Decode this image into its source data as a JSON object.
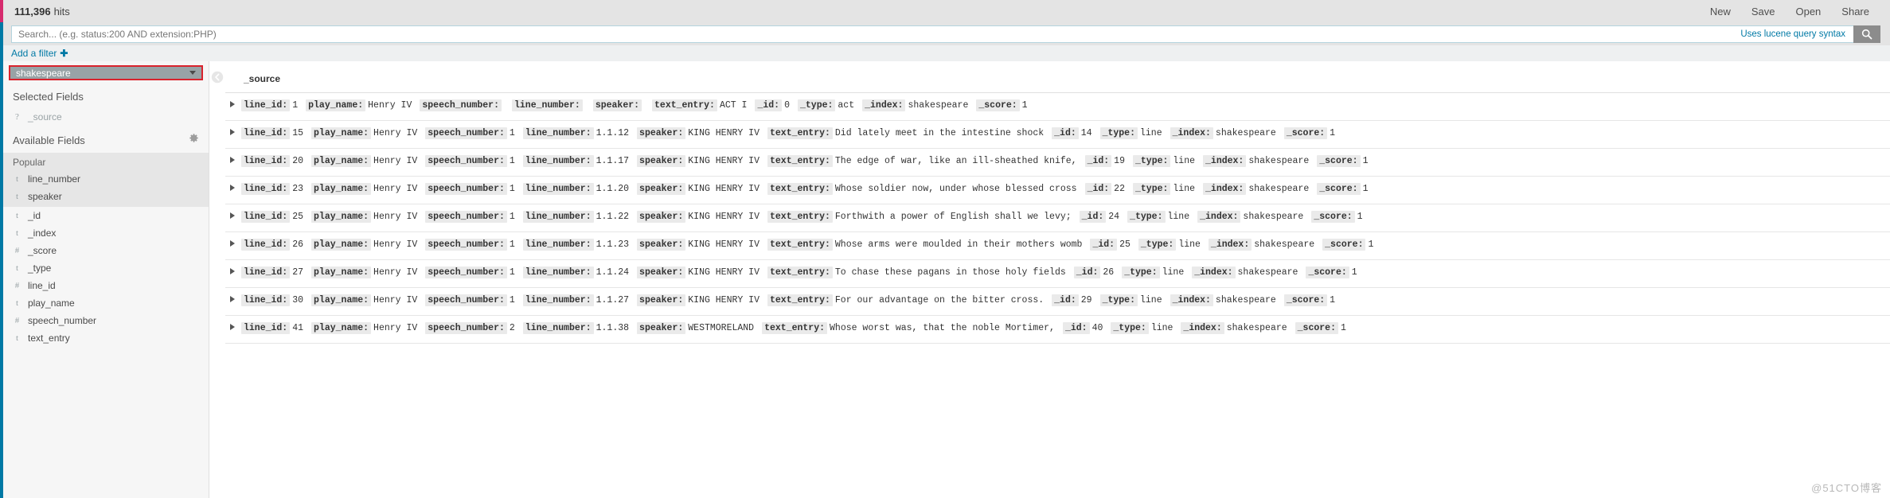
{
  "topbar": {
    "hits_count": "111,396",
    "hits_label": "hits",
    "nav": [
      {
        "label": "New",
        "name": "new"
      },
      {
        "label": "Save",
        "name": "save"
      },
      {
        "label": "Open",
        "name": "open"
      },
      {
        "label": "Share",
        "name": "share"
      }
    ]
  },
  "search": {
    "value": "",
    "placeholder": "Search... (e.g. status:200 AND extension:PHP)",
    "lucene_hint": "Uses lucene query syntax",
    "search_icon": "search-icon"
  },
  "filters": {
    "add_filter_label": "Add a filter",
    "plus": "✚"
  },
  "sidebar": {
    "index_pattern": "shakespeare",
    "selected_fields_title": "Selected Fields",
    "selected_fields": [
      {
        "type": "?",
        "name": "_source",
        "muted": true
      }
    ],
    "available_fields_title": "Available Fields",
    "gear_icon": "gear-icon",
    "popular_label": "Popular",
    "popular_fields": [
      {
        "type": "t",
        "name": "line_number"
      },
      {
        "type": "t",
        "name": "speaker"
      }
    ],
    "available_fields": [
      {
        "type": "t",
        "name": "_id"
      },
      {
        "type": "t",
        "name": "_index"
      },
      {
        "type": "#",
        "name": "_score"
      },
      {
        "type": "t",
        "name": "_type"
      },
      {
        "type": "#",
        "name": "line_id"
      },
      {
        "type": "t",
        "name": "play_name"
      },
      {
        "type": "#",
        "name": "speech_number"
      },
      {
        "type": "t",
        "name": "text_entry"
      }
    ]
  },
  "table": {
    "collapse_icon": "chevron-left-icon",
    "column_header": "_source",
    "rows": [
      {
        "fields": [
          {
            "key": "line_id:",
            "value": "1"
          },
          {
            "key": "play_name:",
            "value": "Henry IV"
          },
          {
            "key": "speech_number:",
            "value": ""
          },
          {
            "key": "line_number:",
            "value": ""
          },
          {
            "key": "speaker:",
            "value": ""
          },
          {
            "key": "text_entry:",
            "value": "ACT I"
          },
          {
            "key": "_id:",
            "value": "0"
          },
          {
            "key": "_type:",
            "value": "act"
          },
          {
            "key": "_index:",
            "value": "shakespeare"
          },
          {
            "key": "_score:",
            "value": "1"
          }
        ]
      },
      {
        "fields": [
          {
            "key": "line_id:",
            "value": "15"
          },
          {
            "key": "play_name:",
            "value": "Henry IV"
          },
          {
            "key": "speech_number:",
            "value": "1"
          },
          {
            "key": "line_number:",
            "value": "1.1.12"
          },
          {
            "key": "speaker:",
            "value": "KING HENRY IV"
          },
          {
            "key": "text_entry:",
            "value": "Did lately meet in the intestine shock"
          },
          {
            "key": "_id:",
            "value": "14"
          },
          {
            "key": "_type:",
            "value": "line"
          },
          {
            "key": "_index:",
            "value": "shakespeare"
          },
          {
            "key": "_score:",
            "value": "1"
          }
        ]
      },
      {
        "fields": [
          {
            "key": "line_id:",
            "value": "20"
          },
          {
            "key": "play_name:",
            "value": "Henry IV"
          },
          {
            "key": "speech_number:",
            "value": "1"
          },
          {
            "key": "line_number:",
            "value": "1.1.17"
          },
          {
            "key": "speaker:",
            "value": "KING HENRY IV"
          },
          {
            "key": "text_entry:",
            "value": "The edge of war, like an ill-sheathed knife,"
          },
          {
            "key": "_id:",
            "value": "19"
          },
          {
            "key": "_type:",
            "value": "line"
          },
          {
            "key": "_index:",
            "value": "shakespeare"
          },
          {
            "key": "_score:",
            "value": "1"
          }
        ]
      },
      {
        "fields": [
          {
            "key": "line_id:",
            "value": "23"
          },
          {
            "key": "play_name:",
            "value": "Henry IV"
          },
          {
            "key": "speech_number:",
            "value": "1"
          },
          {
            "key": "line_number:",
            "value": "1.1.20"
          },
          {
            "key": "speaker:",
            "value": "KING HENRY IV"
          },
          {
            "key": "text_entry:",
            "value": "Whose soldier now, under whose blessed cross"
          },
          {
            "key": "_id:",
            "value": "22"
          },
          {
            "key": "_type:",
            "value": "line"
          },
          {
            "key": "_index:",
            "value": "shakespeare"
          },
          {
            "key": "_score:",
            "value": "1"
          }
        ]
      },
      {
        "fields": [
          {
            "key": "line_id:",
            "value": "25"
          },
          {
            "key": "play_name:",
            "value": "Henry IV"
          },
          {
            "key": "speech_number:",
            "value": "1"
          },
          {
            "key": "line_number:",
            "value": "1.1.22"
          },
          {
            "key": "speaker:",
            "value": "KING HENRY IV"
          },
          {
            "key": "text_entry:",
            "value": "Forthwith a power of English shall we levy;"
          },
          {
            "key": "_id:",
            "value": "24"
          },
          {
            "key": "_type:",
            "value": "line"
          },
          {
            "key": "_index:",
            "value": "shakespeare"
          },
          {
            "key": "_score:",
            "value": "1"
          }
        ]
      },
      {
        "fields": [
          {
            "key": "line_id:",
            "value": "26"
          },
          {
            "key": "play_name:",
            "value": "Henry IV"
          },
          {
            "key": "speech_number:",
            "value": "1"
          },
          {
            "key": "line_number:",
            "value": "1.1.23"
          },
          {
            "key": "speaker:",
            "value": "KING HENRY IV"
          },
          {
            "key": "text_entry:",
            "value": "Whose arms were moulded in their mothers womb"
          },
          {
            "key": "_id:",
            "value": "25"
          },
          {
            "key": "_type:",
            "value": "line"
          },
          {
            "key": "_index:",
            "value": "shakespeare"
          },
          {
            "key": "_score:",
            "value": "1"
          }
        ]
      },
      {
        "fields": [
          {
            "key": "line_id:",
            "value": "27"
          },
          {
            "key": "play_name:",
            "value": "Henry IV"
          },
          {
            "key": "speech_number:",
            "value": "1"
          },
          {
            "key": "line_number:",
            "value": "1.1.24"
          },
          {
            "key": "speaker:",
            "value": "KING HENRY IV"
          },
          {
            "key": "text_entry:",
            "value": "To chase these pagans in those holy fields"
          },
          {
            "key": "_id:",
            "value": "26"
          },
          {
            "key": "_type:",
            "value": "line"
          },
          {
            "key": "_index:",
            "value": "shakespeare"
          },
          {
            "key": "_score:",
            "value": "1"
          }
        ]
      },
      {
        "fields": [
          {
            "key": "line_id:",
            "value": "30"
          },
          {
            "key": "play_name:",
            "value": "Henry IV"
          },
          {
            "key": "speech_number:",
            "value": "1"
          },
          {
            "key": "line_number:",
            "value": "1.1.27"
          },
          {
            "key": "speaker:",
            "value": "KING HENRY IV"
          },
          {
            "key": "text_entry:",
            "value": "For our advantage on the bitter cross."
          },
          {
            "key": "_id:",
            "value": "29"
          },
          {
            "key": "_type:",
            "value": "line"
          },
          {
            "key": "_index:",
            "value": "shakespeare"
          },
          {
            "key": "_score:",
            "value": "1"
          }
        ]
      },
      {
        "fields": [
          {
            "key": "line_id:",
            "value": "41"
          },
          {
            "key": "play_name:",
            "value": "Henry IV"
          },
          {
            "key": "speech_number:",
            "value": "2"
          },
          {
            "key": "line_number:",
            "value": "1.1.38"
          },
          {
            "key": "speaker:",
            "value": "WESTMORELAND"
          },
          {
            "key": "text_entry:",
            "value": "Whose worst was, that the noble Mortimer,"
          },
          {
            "key": "_id:",
            "value": "40"
          },
          {
            "key": "_type:",
            "value": "line"
          },
          {
            "key": "_index:",
            "value": "shakespeare"
          },
          {
            "key": "_score:",
            "value": "1"
          }
        ]
      }
    ]
  },
  "watermark": "@51CTO博客",
  "colors": {
    "accent": "#0079a5",
    "pink_accent": "#d62b6e",
    "highlight_border": "#d9232d",
    "topbar_bg": "#e4e4e4",
    "sidebar_bg": "#f6f6f6"
  }
}
